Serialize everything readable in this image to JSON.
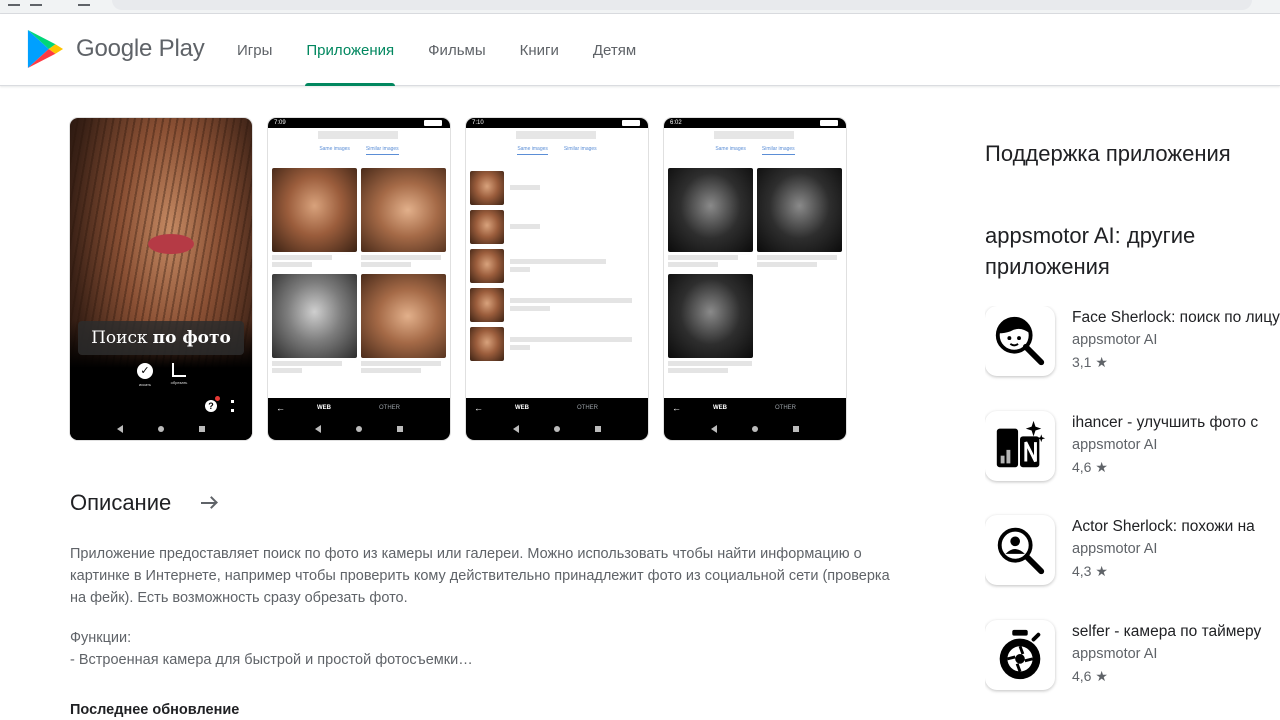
{
  "header": {
    "logo_text": "Google Play",
    "nav": [
      {
        "label": "Игры"
      },
      {
        "label": "Приложения"
      },
      {
        "label": "Фильмы"
      },
      {
        "label": "Книги"
      },
      {
        "label": "Детям"
      }
    ],
    "active_nav": "Приложения"
  },
  "screenshots": {
    "shot1": {
      "caption_plain": "Поиск",
      "caption_bold": "по фото",
      "action1": "искать",
      "action2": "обрезать"
    },
    "status_times": [
      "7:09",
      "7:10",
      "6:02"
    ],
    "tab_same": "Same images",
    "tab_similar": "Similar images",
    "action_web": "WEB",
    "action_other": "OTHER"
  },
  "description": {
    "title": "Описание",
    "body": "Приложение предоставляет поиск по фото из камеры или галереи. Можно использовать чтобы найти информацию о картинке в Интернете, например чтобы проверить кому действительно принадлежит фото из социальной сети (проверка на фейк). Есть возможность сразу обрезать фото.",
    "functions_label": "Функции:",
    "functions_item": "- Встроенная камера для быстрой и простой фотосъемки…",
    "last_update_label": "Последнее обновление"
  },
  "sidebar": {
    "support_title": "Поддержка приложения",
    "more_apps_title": "appsmotor AI: другие приложения",
    "apps": [
      {
        "name": "Face Sherlock: поиск по лицу",
        "developer": "appsmotor AI",
        "rating": "3,1 ★",
        "icon": "face-search-icon"
      },
      {
        "name": "ihancer - улучшить фото с",
        "developer": "appsmotor AI",
        "rating": "4,6 ★",
        "icon": "photo-enhance-icon"
      },
      {
        "name": "Actor Sherlock: похожи на",
        "developer": "appsmotor AI",
        "rating": "4,3 ★",
        "icon": "person-search-icon"
      },
      {
        "name": "selfer - камера по таймеру",
        "developer": "appsmotor AI",
        "rating": "4,6 ★",
        "icon": "timer-camera-icon"
      }
    ]
  },
  "colors": {
    "accent": "#01875f",
    "text_primary": "#202124",
    "text_secondary": "#5f6368"
  }
}
